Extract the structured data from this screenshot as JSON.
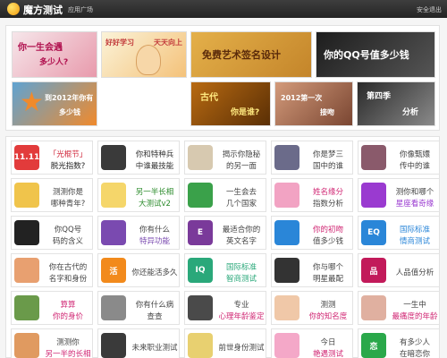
{
  "header": {
    "logo_text": "魔方测试",
    "nav_link": "应用广场",
    "right_link": "安全退出"
  },
  "banners": [
    {
      "line1": "你一生会遇",
      "line2": "多少人?",
      "color": "#b0104e",
      "bg": "#f6e6ea",
      "accent": "#e89aac"
    },
    {
      "line1": "好好学习",
      "line2": "天天向上",
      "color": "#c23a3a",
      "bg": "#fbf3d8",
      "accent": "#f4c27a"
    },
    {
      "line1": "免费艺术签名设计",
      "line2": "",
      "color": "#5a2a0a",
      "bg": "#e4b04a",
      "accent": "#c4852a"
    },
    {
      "line1": "你的QQ号值多少钱",
      "line2": "",
      "color": "#ffffff",
      "bg": "#1d1d1d",
      "accent": "#555555"
    },
    {
      "line1": "到2012年你有",
      "line2": "多少钱",
      "color": "#ffffff",
      "bg": "#5fa3d2",
      "accent": "#f08a2c"
    },
    {
      "line1": "古代",
      "line2": "你是谁?",
      "color": "#ffea80",
      "bg": "#b86a12",
      "accent": "#5a2f05"
    },
    {
      "line1": "2012第一次",
      "line2": "接吻",
      "color": "#ffffff",
      "bg": "#d39a7a",
      "accent": "#7a4632"
    },
    {
      "line1": "第四季",
      "line2": "分析",
      "color": "#ffffff",
      "bg": "#2a2a2a",
      "accent": "#8a8a8a"
    }
  ],
  "tests": [
    {
      "l1": "「光棍节」",
      "l2": "脱光指数?",
      "icon_text": "11.11",
      "icon_bg": "#e23b3b",
      "c1": "#d0263a",
      "c2": "#222222"
    },
    {
      "l1": "你和特种兵",
      "l2": "中谁最技能",
      "icon_text": "",
      "icon_bg": "#3a3a3a",
      "c1": "#333333",
      "c2": "#333333"
    },
    {
      "l1": "揭示你隐秘",
      "l2": "的另一面",
      "icon_text": "",
      "icon_bg": "#d7c9b0",
      "c1": "#444444",
      "c2": "#444444"
    },
    {
      "l1": "你是梦三",
      "l2": "国中的谁",
      "icon_text": "",
      "icon_bg": "#6b6b8a",
      "c1": "#444444",
      "c2": "#444444"
    },
    {
      "l1": "你像甄嬛",
      "l2": "传中的谁",
      "icon_text": "",
      "icon_bg": "#8a5a6b",
      "c1": "#444444",
      "c2": "#444444"
    },
    {
      "l1": "测测你是",
      "l2": "哪种青年?",
      "icon_text": "",
      "icon_bg": "#f0c44b",
      "c1": "#444444",
      "c2": "#444444"
    },
    {
      "l1": "另一半长相",
      "l2": "大测试v2",
      "icon_text": "",
      "icon_bg": "#f5d66a",
      "c1": "#2a8a2a",
      "c2": "#2a8a2a"
    },
    {
      "l1": "一生会去",
      "l2": "几个国家",
      "icon_text": "",
      "icon_bg": "#3aa14a",
      "c1": "#444444",
      "c2": "#444444"
    },
    {
      "l1": "姓名缘分",
      "l2": "指数分析",
      "icon_text": "",
      "icon_bg": "#f2a3c3",
      "c1": "#d02673",
      "c2": "#444444"
    },
    {
      "l1": "测你和哪个",
      "l2": "星座看奇缘",
      "icon_text": "",
      "icon_bg": "#9a3ad0",
      "c1": "#444444",
      "c2": "#9a3ad0"
    },
    {
      "l1": "你QQ号",
      "l2": "码的含义",
      "icon_text": "",
      "icon_bg": "#222222",
      "c1": "#444444",
      "c2": "#444444"
    },
    {
      "l1": "你有什么",
      "l2": "特异功能",
      "icon_text": "",
      "icon_bg": "#7a4ab0",
      "c1": "#444444",
      "c2": "#7a4ab0"
    },
    {
      "l1": "最适合你的",
      "l2": "英文名字",
      "icon_text": "E",
      "icon_bg": "#7a3a9a",
      "c1": "#444444",
      "c2": "#444444"
    },
    {
      "l1": "你的初吻",
      "l2": "值多少钱",
      "icon_text": "",
      "icon_bg": "#2a86d8",
      "c1": "#d02673",
      "c2": "#444444"
    },
    {
      "l1": "国际标准",
      "l2": "情商测试",
      "icon_text": "EQ",
      "icon_bg": "#2a86d8",
      "c1": "#2a86d8",
      "c2": "#2a86d8"
    },
    {
      "l1": "你在古代的",
      "l2": "名字和身份",
      "icon_text": "",
      "icon_bg": "#e8a070",
      "c1": "#444444",
      "c2": "#444444"
    },
    {
      "l1": "你还能活多久",
      "l2": "",
      "icon_text": "活",
      "icon_bg": "#f28a1c",
      "c1": "#444444",
      "c2": "#444444"
    },
    {
      "l1": "国际标准",
      "l2": "智商测试",
      "icon_text": "IQ",
      "icon_bg": "#2aa87a",
      "c1": "#2aa87a",
      "c2": "#2aa87a"
    },
    {
      "l1": "你与哪个",
      "l2": "明星最配",
      "icon_text": "",
      "icon_bg": "#333333",
      "c1": "#444444",
      "c2": "#444444"
    },
    {
      "l1": "人品值分析",
      "l2": "",
      "icon_text": "品",
      "icon_bg": "#c21a5a",
      "c1": "#444444",
      "c2": "#444444"
    },
    {
      "l1": "算算",
      "l2": "你的身价",
      "icon_text": "",
      "icon_bg": "#6a9a4a",
      "c1": "#d02673",
      "c2": "#d02673"
    },
    {
      "l1": "你有什么病",
      "l2": "查查",
      "icon_text": "",
      "icon_bg": "#8a8a8a",
      "c1": "#444444",
      "c2": "#444444"
    },
    {
      "l1": "专业",
      "l2": "心理年龄鉴定",
      "icon_text": "",
      "icon_bg": "#4a4a4a",
      "c1": "#444444",
      "c2": "#d02673"
    },
    {
      "l1": "测测",
      "l2": "你的知名度",
      "icon_text": "",
      "icon_bg": "#f0c8a8",
      "c1": "#444444",
      "c2": "#d02673"
    },
    {
      "l1": "一生中",
      "l2": "最痛度的年龄",
      "icon_text": "",
      "icon_bg": "#e0b0a0",
      "c1": "#444444",
      "c2": "#d02673"
    },
    {
      "l1": "测测你",
      "l2": "另一半的长相",
      "icon_text": "",
      "icon_bg": "#e09a60",
      "c1": "#444444",
      "c2": "#d02673"
    },
    {
      "l1": "未来职业测试",
      "l2": "",
      "icon_text": "",
      "icon_bg": "#3a3a3a",
      "c1": "#444444",
      "c2": "#444444"
    },
    {
      "l1": "前世身份测试",
      "l2": "",
      "icon_text": "",
      "icon_bg": "#e8d070",
      "c1": "#444444",
      "c2": "#444444"
    },
    {
      "l1": "今日",
      "l2": "艳遇测试",
      "icon_text": "",
      "icon_bg": "#f4a8c8",
      "c1": "#444444",
      "c2": "#d02673"
    },
    {
      "l1": "有多少人",
      "l2": "在暗恋你",
      "icon_text": "恋",
      "icon_bg": "#2aa84a",
      "c1": "#444444",
      "c2": "#444444"
    }
  ]
}
